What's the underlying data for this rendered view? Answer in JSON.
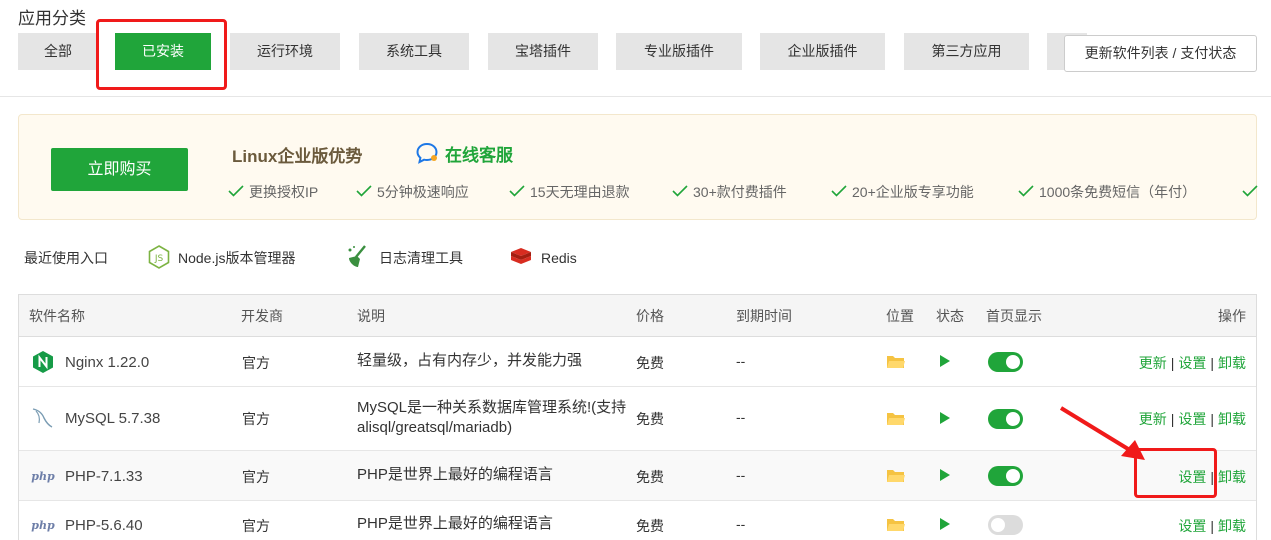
{
  "section_title": "应用分类",
  "category_tabs": [
    {
      "label": "全部",
      "active": false
    },
    {
      "label": "已安装",
      "active": true
    },
    {
      "label": "运行环境",
      "active": false
    },
    {
      "label": "系统工具",
      "active": false
    },
    {
      "label": "宝塔插件",
      "active": false
    },
    {
      "label": "专业版插件",
      "active": false
    },
    {
      "label": "企业版插件",
      "active": false
    },
    {
      "label": "第三方应用",
      "active": false
    },
    {
      "label": "",
      "active": false
    }
  ],
  "update_button": "更新软件列表 / 支付状态",
  "promo": {
    "buy_label": "立即购买",
    "title": "Linux企业版优势",
    "customer_service": "在线客服",
    "features": [
      "更换授权IP",
      "5分钟极速响应",
      "15天无理由退款",
      "30+款付费插件",
      "20+企业版专享功能",
      "1000条免费短信（年付）"
    ]
  },
  "recent": {
    "label": "最近使用入口",
    "items": [
      {
        "label": "Node.js版本管理器",
        "icon": "nodejs-icon"
      },
      {
        "label": "日志清理工具",
        "icon": "broom-icon"
      },
      {
        "label": "Redis",
        "icon": "redis-icon"
      }
    ]
  },
  "table": {
    "headers": {
      "name": "软件名称",
      "developer": "开发商",
      "description": "说明",
      "price": "价格",
      "expiry": "到期时间",
      "location": "位置",
      "status": "状态",
      "homepage": "首页显示",
      "actions": "操作"
    },
    "rows": [
      {
        "name": "Nginx 1.22.0",
        "icon": "nginx-icon",
        "developer": "官方",
        "description": "轻量级，占有内存少，并发能力强",
        "price": "免费",
        "expiry": "--",
        "homepage": true,
        "update": "更新",
        "settings": "设置",
        "uninstall": "卸载"
      },
      {
        "name": "MySQL 5.7.38",
        "icon": "mysql-icon",
        "developer": "官方",
        "description": "MySQL是一种关系数据库管理系统!(支持alisql/greatsql/mariadb)",
        "price": "免费",
        "expiry": "--",
        "homepage": true,
        "update": "更新",
        "settings": "设置",
        "uninstall": "卸载"
      },
      {
        "name": "PHP-7.1.33",
        "icon": "php-icon",
        "icon_text": "php",
        "developer": "官方",
        "description": "PHP是世界上最好的编程语言",
        "price": "免费",
        "expiry": "--",
        "homepage": true,
        "settings": "设置",
        "uninstall": "卸载"
      },
      {
        "name": "PHP-5.6.40",
        "icon": "php-icon",
        "icon_text": "php",
        "developer": "官方",
        "description": "PHP是世界上最好的编程语言",
        "price": "免费",
        "expiry": "--",
        "homepage": false,
        "settings": "设置",
        "uninstall": "卸载"
      }
    ]
  },
  "colors": {
    "accent": "#20a53a",
    "highlight": "#f01a1a",
    "folder": "#f5c342"
  }
}
